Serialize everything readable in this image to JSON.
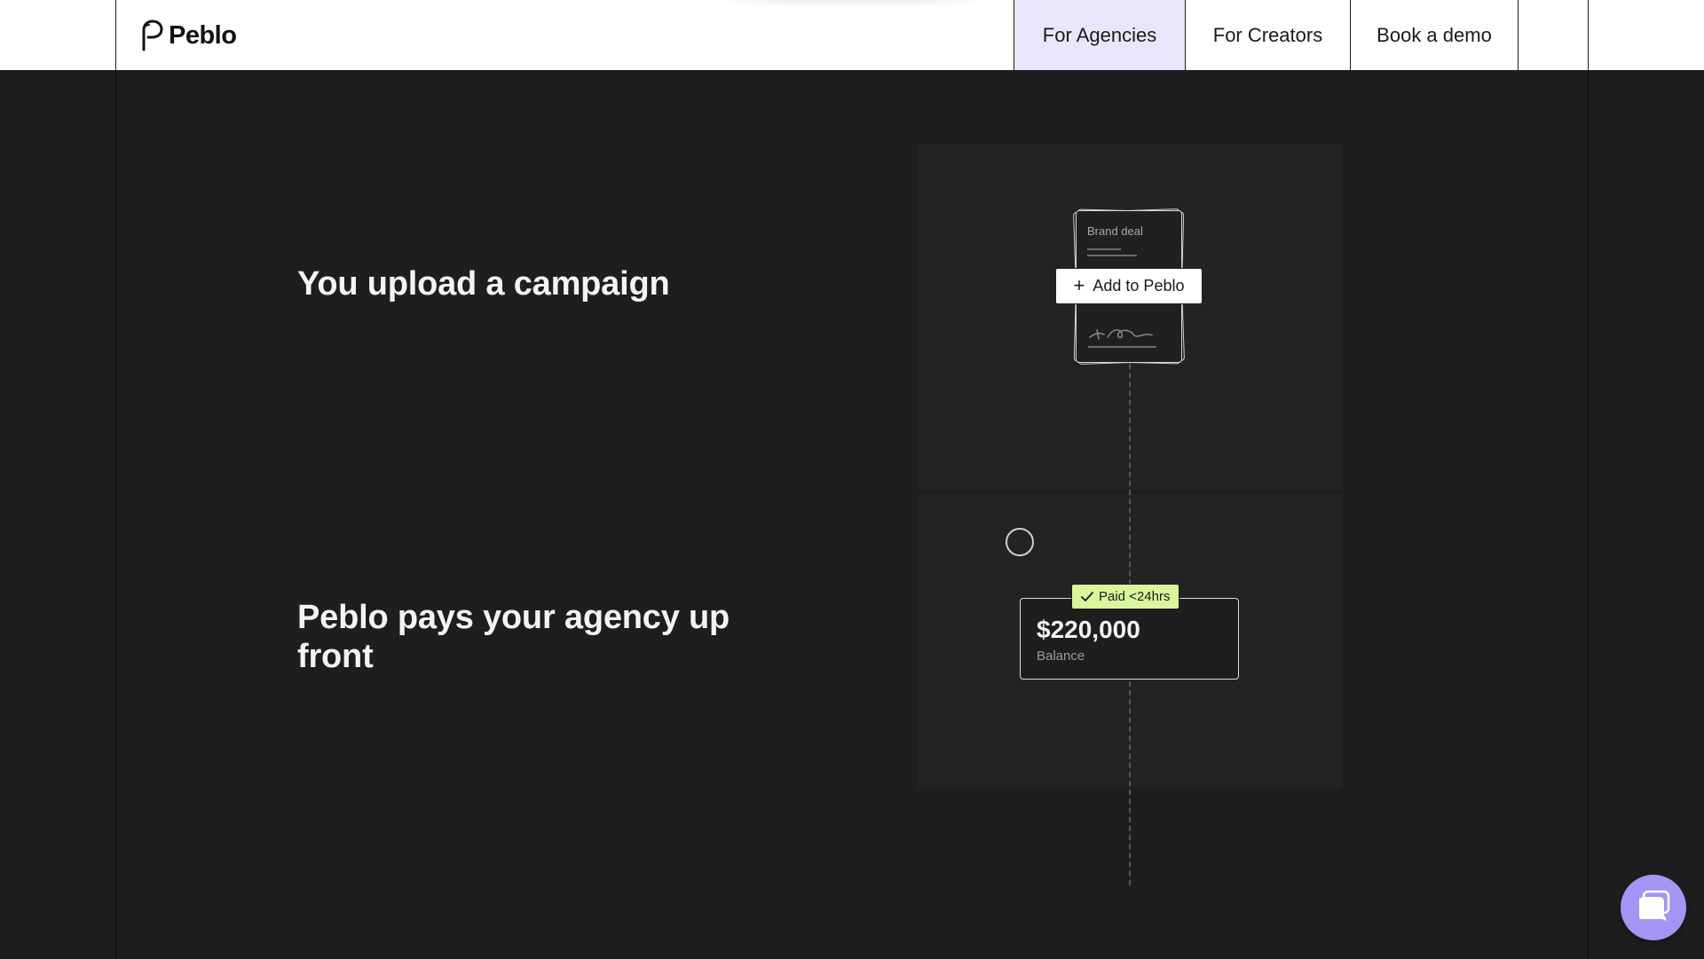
{
  "header": {
    "logo_text": "Peblo",
    "nav": [
      {
        "label": "For Agencies",
        "active": true
      },
      {
        "label": "For Creators",
        "active": false
      },
      {
        "label": "Book a demo",
        "active": false
      }
    ]
  },
  "steps": [
    {
      "title": "You upload a campaign"
    },
    {
      "title": "Peblo pays your agency up front"
    }
  ],
  "illustration": {
    "document_label": "Brand deal",
    "add_button_label": "Add to Peblo",
    "badge_label": "Paid <24hrs",
    "balance_amount": "$220,000",
    "balance_label": "Balance"
  },
  "colors": {
    "active_nav_bg": "#e9e6fb",
    "dark_bg": "#1e1e1e",
    "badge_bg": "#d9f79a",
    "chat_button": "#a694f4"
  },
  "icons": [
    "peblo-logo-icon",
    "plus-icon",
    "check-icon",
    "chat-icon"
  ]
}
